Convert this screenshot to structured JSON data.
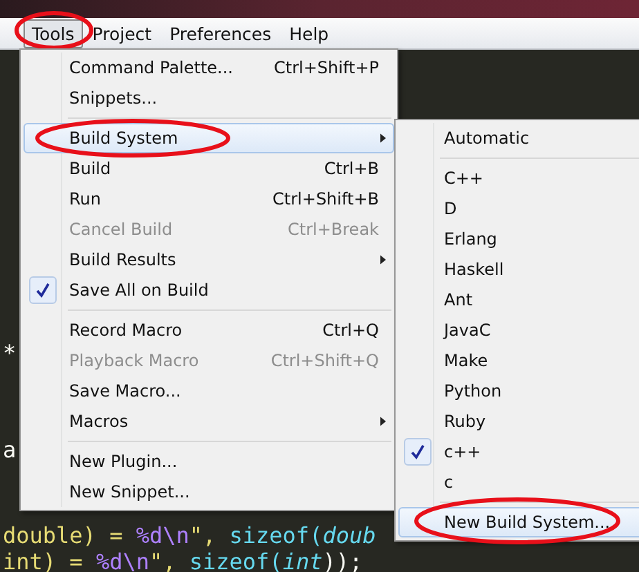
{
  "menu_bar": [
    {
      "label": "Tools",
      "selected": true,
      "circled": true
    },
    {
      "label": "Project",
      "selected": false,
      "circled": false
    },
    {
      "label": "Preferences",
      "selected": false,
      "circled": false
    },
    {
      "label": "Help",
      "selected": false,
      "circled": false
    }
  ],
  "editor_lines": [
    {
      "tokens": [
        {
          "text": "*",
          "kind": "plain"
        }
      ]
    },
    {
      "tokens": [
        {
          "text": "a",
          "kind": "plain"
        }
      ]
    },
    {
      "tokens": [
        {
          "text": "double) = ",
          "kind": "string"
        },
        {
          "text": "%d\\n",
          "kind": "format"
        },
        {
          "text": "\", ",
          "kind": "string"
        },
        {
          "text": "sizeof(",
          "kind": "func"
        },
        {
          "text": "doub",
          "kind": "type"
        }
      ]
    },
    {
      "tokens": [
        {
          "text": "int) = ",
          "kind": "string"
        },
        {
          "text": "%d\\n",
          "kind": "format"
        },
        {
          "text": "\", ",
          "kind": "string"
        },
        {
          "text": "sizeof(",
          "kind": "func"
        },
        {
          "text": "int",
          "kind": "type"
        },
        {
          "text": "));",
          "kind": "plain"
        }
      ]
    }
  ],
  "tools_menu": {
    "items": [
      {
        "kind": "item",
        "label": "Command Palette...",
        "shortcut": "Ctrl+Shift+P",
        "disabled": false,
        "checked": false,
        "submenu": false,
        "selected": false,
        "circled": false
      },
      {
        "kind": "item",
        "label": "Snippets...",
        "disabled": false,
        "checked": false,
        "submenu": false,
        "selected": false,
        "circled": false
      },
      {
        "kind": "separator"
      },
      {
        "kind": "item",
        "label": "Build System",
        "disabled": false,
        "checked": false,
        "submenu": true,
        "selected": true,
        "circled": true
      },
      {
        "kind": "item",
        "label": "Build",
        "shortcut": "Ctrl+B",
        "disabled": false,
        "checked": false,
        "submenu": false,
        "selected": false,
        "circled": false
      },
      {
        "kind": "item",
        "label": "Run",
        "shortcut": "Ctrl+Shift+B",
        "disabled": false,
        "checked": false,
        "submenu": false,
        "selected": false,
        "circled": false
      },
      {
        "kind": "item",
        "label": "Cancel Build",
        "shortcut": "Ctrl+Break",
        "disabled": true,
        "checked": false,
        "submenu": false,
        "selected": false,
        "circled": false
      },
      {
        "kind": "item",
        "label": "Build Results",
        "disabled": false,
        "checked": false,
        "submenu": true,
        "selected": false,
        "circled": false
      },
      {
        "kind": "item",
        "label": "Save All on Build",
        "disabled": false,
        "checked": true,
        "submenu": false,
        "selected": false,
        "circled": false
      },
      {
        "kind": "separator"
      },
      {
        "kind": "item",
        "label": "Record Macro",
        "shortcut": "Ctrl+Q",
        "disabled": false,
        "checked": false,
        "submenu": false,
        "selected": false,
        "circled": false
      },
      {
        "kind": "item",
        "label": "Playback Macro",
        "shortcut": "Ctrl+Shift+Q",
        "disabled": true,
        "checked": false,
        "submenu": false,
        "selected": false,
        "circled": false
      },
      {
        "kind": "item",
        "label": "Save Macro...",
        "disabled": false,
        "checked": false,
        "submenu": false,
        "selected": false,
        "circled": false
      },
      {
        "kind": "item",
        "label": "Macros",
        "disabled": false,
        "checked": false,
        "submenu": true,
        "selected": false,
        "circled": false
      },
      {
        "kind": "separator"
      },
      {
        "kind": "item",
        "label": "New Plugin...",
        "disabled": false,
        "checked": false,
        "submenu": false,
        "selected": false,
        "circled": false
      },
      {
        "kind": "item",
        "label": "New Snippet...",
        "disabled": false,
        "checked": false,
        "submenu": false,
        "selected": false,
        "circled": false
      }
    ]
  },
  "build_system_menu": {
    "items": [
      {
        "kind": "item",
        "label": "Automatic",
        "checked": false,
        "selected": false,
        "circled": false
      },
      {
        "kind": "separator"
      },
      {
        "kind": "item",
        "label": "C++",
        "checked": false,
        "selected": false,
        "circled": false
      },
      {
        "kind": "item",
        "label": "D",
        "checked": false,
        "selected": false,
        "circled": false
      },
      {
        "kind": "item",
        "label": "Erlang",
        "checked": false,
        "selected": false,
        "circled": false
      },
      {
        "kind": "item",
        "label": "Haskell",
        "checked": false,
        "selected": false,
        "circled": false
      },
      {
        "kind": "item",
        "label": "Ant",
        "checked": false,
        "selected": false,
        "circled": false
      },
      {
        "kind": "item",
        "label": "JavaC",
        "checked": false,
        "selected": false,
        "circled": false
      },
      {
        "kind": "item",
        "label": "Make",
        "checked": false,
        "selected": false,
        "circled": false
      },
      {
        "kind": "item",
        "label": "Python",
        "checked": false,
        "selected": false,
        "circled": false
      },
      {
        "kind": "item",
        "label": "Ruby",
        "checked": false,
        "selected": false,
        "circled": false
      },
      {
        "kind": "item",
        "label": "c++",
        "checked": true,
        "selected": false,
        "circled": false
      },
      {
        "kind": "item",
        "label": "c",
        "checked": false,
        "selected": false,
        "circled": false
      },
      {
        "kind": "separator"
      },
      {
        "kind": "item",
        "label": "New Build System...",
        "checked": false,
        "selected": true,
        "circled": true
      }
    ]
  }
}
